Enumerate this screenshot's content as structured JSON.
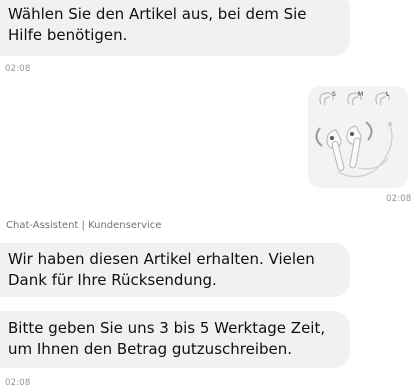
{
  "messages": [
    {
      "text": "Wählen Sie den Artikel aus, bei dem Sie Hilfe benötigen.",
      "time": "02:08"
    },
    {
      "text": "Wir haben diesen Artikel erhalten. Vielen Dank für Ihre Rücksendung."
    },
    {
      "text": "Bitte geben Sie uns 3 bis 5 Werktage Zeit, um Ihnen den Betrag gutzuschreiben.",
      "time": "02:08"
    }
  ],
  "user_item": {
    "sizes": [
      "S",
      "M",
      "L"
    ],
    "time": "02:08"
  },
  "sender_label": "Chat-Assistent | Kundenservice",
  "colors": {
    "bubble_bg": "#f0f2f2",
    "card_bg": "#f3f3f3",
    "timestamp": "#8d9696"
  }
}
